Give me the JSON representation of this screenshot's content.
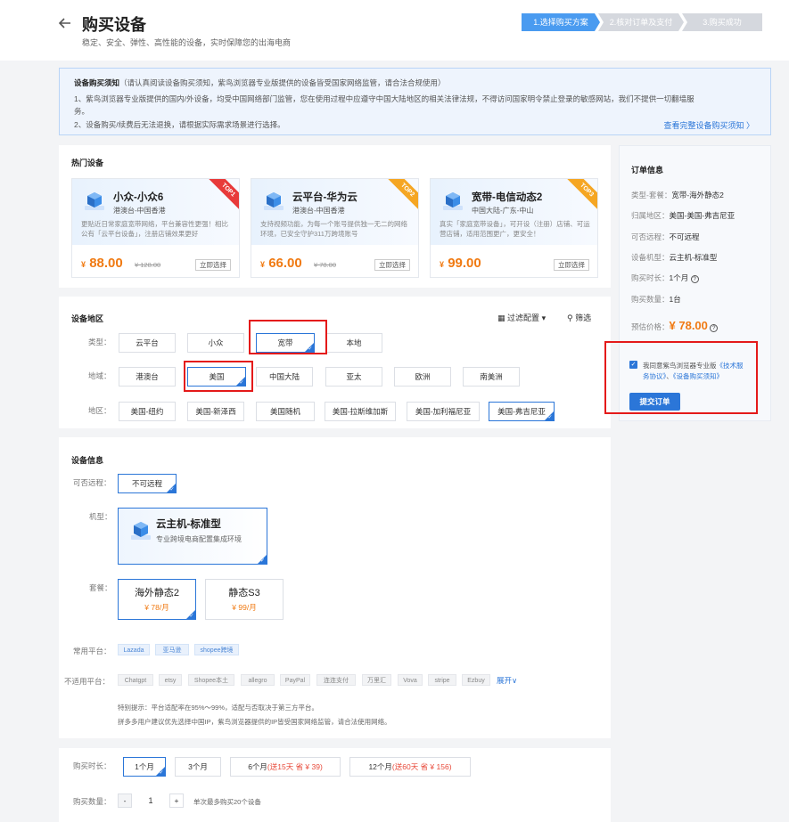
{
  "header": {
    "title": "购买设备",
    "subtitle": "稳定、安全、弹性、高性能的设备，实时保障您的出海电商"
  },
  "steps": [
    "1.选择购买方案",
    "2.核对订单及支付",
    "3.购买成功"
  ],
  "notice": {
    "title": "设备购买须知",
    "title_note": "（请认真阅读设备购买须知，紫鸟浏览器专业版提供的设备皆受国家网络监管，请合法合规使用）",
    "line1a": "1、紫鸟浏览器专业版提供的国内/外设备，均受中国网络部门监管，您在使用过程中应遵守中国大陆地区的相关法律法规，不得访问国家明令禁止登录的敏感网站，我们不提供一切翻墙服",
    "line1b": "务。",
    "line2": "2、设备购买/续费后无法退换，请根据实际需求场景进行选择。",
    "link": "查看完整设备购买须知 〉"
  },
  "hot": {
    "title": "热门设备",
    "cards": [
      {
        "name": "小众-小众6",
        "region": "港澳台-中国香港",
        "desc": "更贴近日常家庭宽带网络，平台兼容性更强！相比公有「云平台设备」，注册店铺效果更好",
        "price": "88.00",
        "currency": "¥",
        "old": "¥ 128.00",
        "btn": "立即选择",
        "rank": "TOP1",
        "color": "#e83a3a"
      },
      {
        "name": "云平台-华为云",
        "region": "港澳台-中国香港",
        "desc": "支持视频功能，为每一个账号提供独一无二的网络环境，已安全守护311万跨境账号",
        "price": "66.00",
        "currency": "¥",
        "old": "¥ 78.00",
        "btn": "立即选择",
        "rank": "TOP2",
        "color": "#f5a623"
      },
      {
        "name": "宽带-电信动态2",
        "region": "中国大陆-广东-中山",
        "desc": "真实「家庭宽带设备」，可开设（注册）店铺、可运营店铺，适用范围更广，更安全！",
        "price": "99.00",
        "currency": "¥",
        "old": "",
        "btn": "立即选择",
        "rank": "TOP3",
        "color": "#f5a623"
      }
    ]
  },
  "region": {
    "title": "设备地区",
    "filter": "过滤配置",
    "filter2": "筛选",
    "type_label": "类型：",
    "types": [
      "云平台",
      "小众",
      "宽带",
      "本地"
    ],
    "area_label": "地域：",
    "areas": [
      "港澳台",
      "美国",
      "中国大陆",
      "亚太",
      "欧洲",
      "南美洲"
    ],
    "zone_label": "地区：",
    "zones": [
      "美国-纽约",
      "美国-新泽西",
      "美国随机",
      "美国-拉斯维加斯",
      "美国-加利福尼亚",
      "美国-弗吉尼亚"
    ]
  },
  "device": {
    "title": "设备信息",
    "remote_label": "可否远程：",
    "remote": "不可远程",
    "model_label": "机型：",
    "model_name": "云主机-标准型",
    "model_desc": "专业跨境电商配置集成环境",
    "plan_label": "套餐：",
    "plans": [
      {
        "name": "海外静态2",
        "price": "¥ 78/月"
      },
      {
        "name": "静态S3",
        "price": "¥ 99/月"
      }
    ],
    "common_label": "常用平台：",
    "common": [
      "Lazada",
      "亚马逊",
      "shopee跨境"
    ],
    "unfit_label": "不适用平台：",
    "unfit": [
      "Chatgpt",
      "etsy",
      "Shopee本土",
      "allegro",
      "PayPal",
      "连连支付",
      "万里汇",
      "Vova",
      "stripe",
      "Ezbuy"
    ],
    "expand": "展开",
    "tip1": "特别提示：平台适配率在95%～99%，适配与否取决于第三方平台。",
    "tip2": "拼多多用户建议优先选择中国IP，紫鸟浏览器提供的IP皆受国家网络监管，请合法使用网络。"
  },
  "duration": {
    "label": "购买时长：",
    "opts": [
      {
        "t": "1个月",
        "extra": ""
      },
      {
        "t": "3个月",
        "extra": ""
      },
      {
        "t": "6个月",
        "extra": "(送15天 省 ¥ 39)"
      },
      {
        "t": "12个月",
        "extra": "(送60天 省 ¥ 156)"
      }
    ]
  },
  "qty": {
    "label": "购买数量：",
    "minus": "-",
    "value": "1",
    "plus": "+",
    "note": "单次最多购买20个设备"
  },
  "order": {
    "title": "订单信息",
    "rows": [
      {
        "k": "类型-套餐：",
        "v": "宽带-海外静态2"
      },
      {
        "k": "归属地区：",
        "v": "美国-美国-弗吉尼亚"
      },
      {
        "k": "可否远程：",
        "v": "不可远程"
      },
      {
        "k": "设备机型：",
        "v": "云主机-标准型"
      },
      {
        "k": "购买时长：",
        "v": "1个月"
      },
      {
        "k": "购买数量：",
        "v": "1台"
      }
    ],
    "est_label": "预估价格：",
    "est": "¥ 78.00",
    "agree_pre": "我同意紫鸟浏览器专业版",
    "agree_l1": "《技术服务协议》",
    "agree_mid": "、",
    "agree_l2": "《设备购买须知》",
    "submit": "提交订单"
  }
}
